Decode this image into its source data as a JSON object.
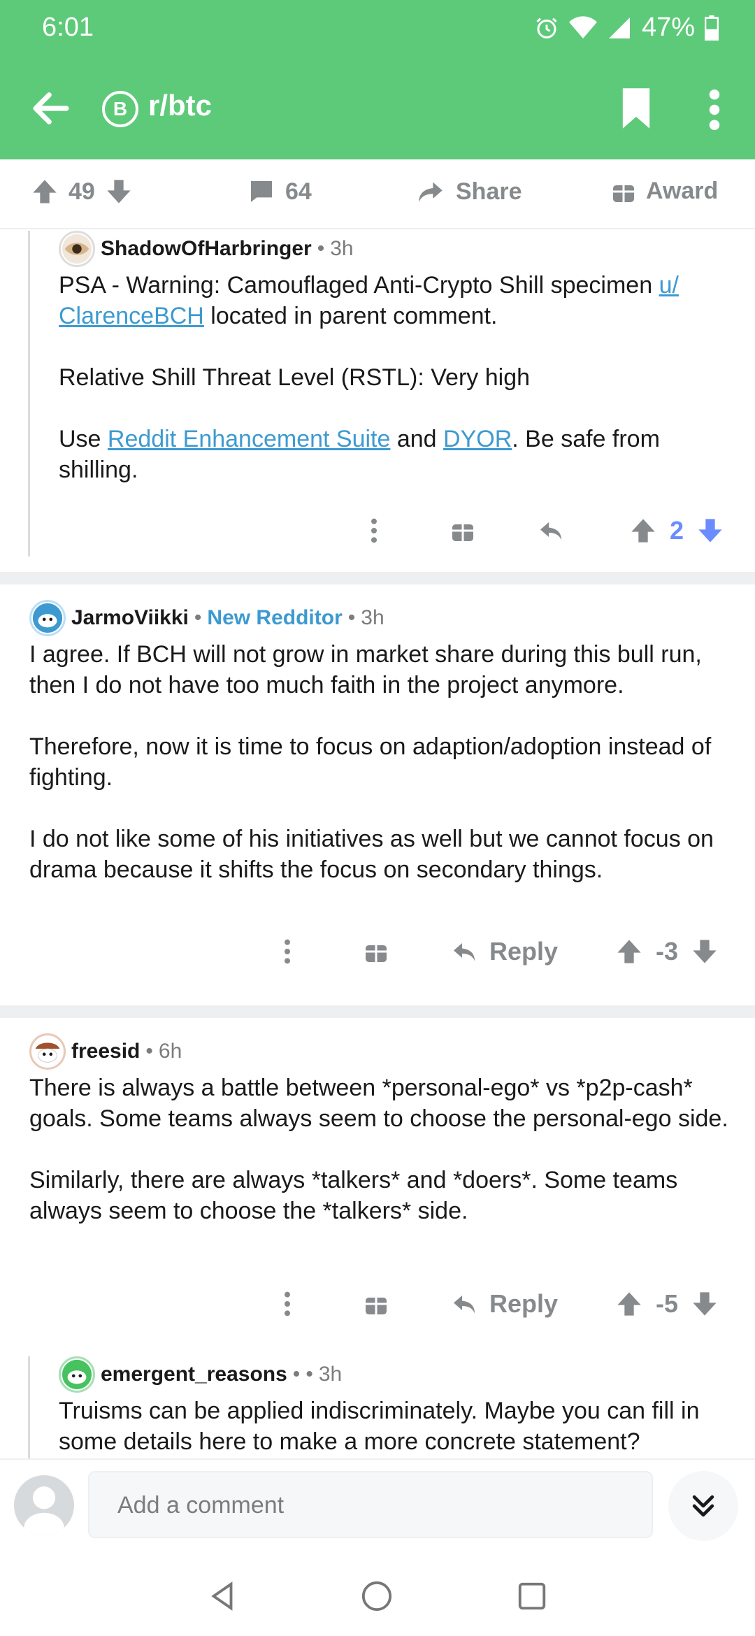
{
  "status": {
    "time": "6:01",
    "battery": "47%"
  },
  "header": {
    "subreddit": "r/btc",
    "badge": "B"
  },
  "actionbar": {
    "upvotes": "49",
    "comments": "64",
    "share_label": "Share",
    "award_label": "Award"
  },
  "comments": [
    {
      "author": "ShadowOfHarbringer",
      "time": "3h",
      "body": {
        "p1_pre": "PSA - Warning: Camouflaged Anti-Crypto Shill specimen ",
        "p1_link": "u/ ClarenceBCH",
        "p1_post": " located in parent comment.",
        "p2": "Relative Shill Threat Level (RSTL): Very high",
        "p3_pre": "Use ",
        "p3_link1": "Reddit Enhancement Suite",
        "p3_mid": " and ",
        "p3_link2": "DYOR",
        "p3_post": ". Be safe from shilling."
      },
      "score": "2"
    },
    {
      "author": "JarmoViikki",
      "flair": "New Redditor",
      "time": "3h",
      "paragraphs": [
        "I agree. If BCH will not grow in market share during this bull run, then I do not have too much faith in the project anymore.",
        "Therefore, now it is time to focus on adaption/adoption instead of fighting.",
        "I do not like some of his initiatives as well but we cannot focus on drama because it shifts the focus on secondary things."
      ],
      "reply_label": "Reply",
      "score": "-3"
    },
    {
      "author": "freesid",
      "time": "6h",
      "paragraphs": [
        "There is always a battle between *personal-ego* vs *p2p-cash* goals.  Some teams always seem to choose the personal-ego side.",
        "Similarly, there are always *talkers* and *doers*. Some teams always seem to choose the *talkers* side."
      ],
      "reply_label": "Reply",
      "score": "-5"
    },
    {
      "author": "emergent_reasons",
      "time": "3h",
      "paragraphs": [
        "Truisms can be applied indiscriminately. Maybe you can fill in some details here to make a more concrete statement?"
      ]
    }
  ],
  "composer": {
    "placeholder": "Add a comment"
  },
  "colors": {
    "brand_green": "#5dca79",
    "link_blue": "#3d9ad1",
    "upvote_blue": "#6a8cff"
  }
}
